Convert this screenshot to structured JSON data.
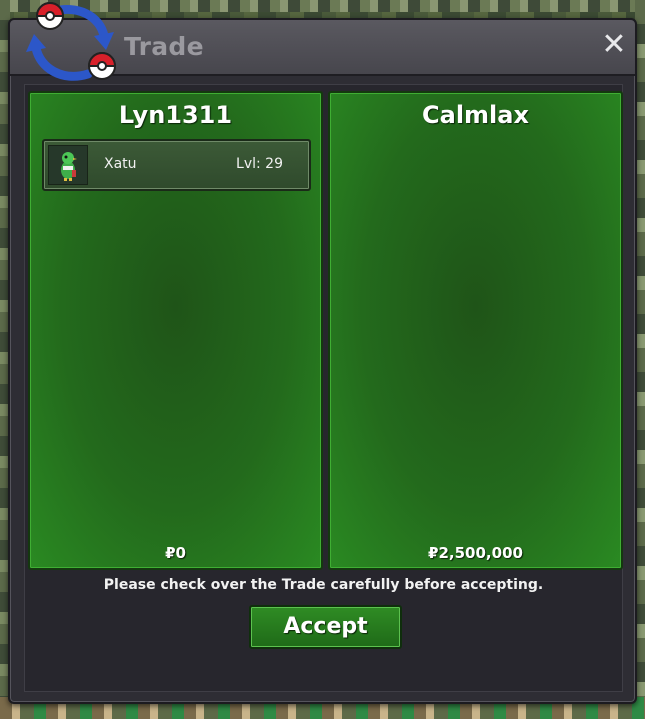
{
  "window": {
    "title": "Trade",
    "close_label": "✕"
  },
  "trade": {
    "left": {
      "player_name": "Lyn1311",
      "money": "₽0",
      "pokemon": [
        {
          "name": "Xatu",
          "level": "Lvl: 29"
        }
      ]
    },
    "right": {
      "player_name": "Calmlax",
      "money": "₽2,500,000",
      "pokemon": []
    }
  },
  "notice": "Please check over the Trade carefully before accepting.",
  "accept_label": "Accept",
  "icons": {
    "logo": "trade-arrows-pokeballs-icon",
    "close": "close-icon",
    "sprite": "pokemon-sprite-icon"
  },
  "colors": {
    "panel_green": "#236a1c",
    "window_bg": "#2e2d34",
    "title_text": "#9a999f",
    "accept_green": "#2f8c24"
  }
}
